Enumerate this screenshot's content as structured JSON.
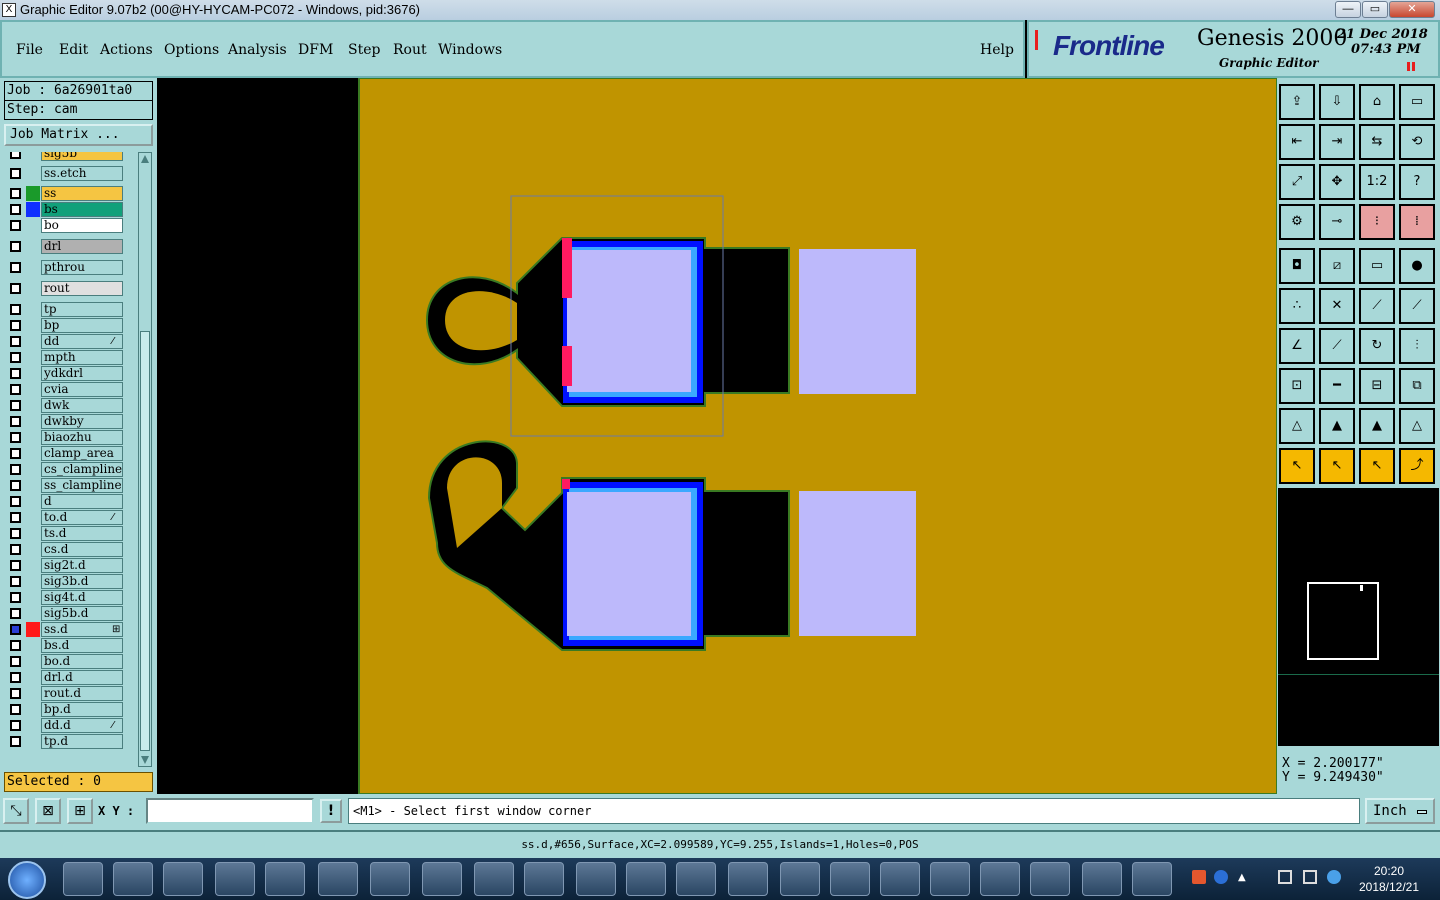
{
  "window": {
    "title": "Graphic Editor 9.07b2 (00@HY-HYCAM-PC072 - Windows, pid:3676)",
    "app_icon": "X",
    "minimize": "—",
    "maximize": "▭",
    "close": "✕"
  },
  "menu": {
    "file": "File",
    "edit": "Edit",
    "actions": "Actions",
    "options": "Options",
    "analysis": "Analysis",
    "dfm": "DFM",
    "step": "Step",
    "rout": "Rout",
    "windows": "Windows",
    "help": "Help"
  },
  "brand": {
    "logo": "Frontline",
    "product": "Genesis 2000",
    "subtitle": "Graphic Editor",
    "date": "21 Dec 2018",
    "time": "07:43 PM"
  },
  "job": {
    "job_label": "Job : 6a26901ta0",
    "step_label": "Step: cam",
    "matrix_button": "Job Matrix ..."
  },
  "layers": [
    {
      "name": "sig5b",
      "color": "#f5c542"
    },
    {
      "name": "ss.etch",
      "color": ""
    },
    {
      "name": "ss",
      "color": "#f5c542",
      "swatch": "#1a9a2a"
    },
    {
      "name": "bs",
      "color": "#11a07a",
      "swatch": "#1030ff"
    },
    {
      "name": "bo",
      "color": "#ffffff"
    },
    {
      "name": "drl",
      "color": "#b0b0b0"
    },
    {
      "name": "pthrou",
      "color": ""
    },
    {
      "name": "rout",
      "color": "#e0e0e0"
    },
    {
      "name": "tp",
      "color": ""
    },
    {
      "name": "bp",
      "color": ""
    },
    {
      "name": "dd",
      "color": "",
      "mark": "⁄"
    },
    {
      "name": "mpth",
      "color": ""
    },
    {
      "name": "ydkdrl",
      "color": ""
    },
    {
      "name": "cvia",
      "color": ""
    },
    {
      "name": "dwk",
      "color": ""
    },
    {
      "name": "dwkby",
      "color": ""
    },
    {
      "name": "biaozhu",
      "color": ""
    },
    {
      "name": "clamp_area",
      "color": ""
    },
    {
      "name": "cs_clampline",
      "color": ""
    },
    {
      "name": "ss_clampline",
      "color": ""
    },
    {
      "name": "d",
      "color": ""
    },
    {
      "name": "to.d",
      "color": "",
      "mark": "⁄"
    },
    {
      "name": "ts.d",
      "color": ""
    },
    {
      "name": "cs.d",
      "color": ""
    },
    {
      "name": "sig2t.d",
      "color": ""
    },
    {
      "name": "sig3b.d",
      "color": ""
    },
    {
      "name": "sig4t.d",
      "color": ""
    },
    {
      "name": "sig5b.d",
      "color": ""
    },
    {
      "name": "ss.d",
      "color": "",
      "swatch": "#ff1a1a",
      "mark": "⊞"
    },
    {
      "name": "bs.d",
      "color": ""
    },
    {
      "name": "bo.d",
      "color": ""
    },
    {
      "name": "drl.d",
      "color": ""
    },
    {
      "name": "rout.d",
      "color": ""
    },
    {
      "name": "bp.d",
      "color": ""
    },
    {
      "name": "dd.d",
      "color": "",
      "mark": "⁄"
    },
    {
      "name": "tp.d",
      "color": ""
    }
  ],
  "selected_label": "Selected : 0",
  "command": {
    "xy_label": "X Y :",
    "input_value": "",
    "prompt": "<M1> - Select first window corner",
    "units": "Inch",
    "warn_icon": "!"
  },
  "status": {
    "text": "ss.d,#656,Surface,XC=2.099589,YC=9.255,Islands=1,Holes=0,POS"
  },
  "coords": {
    "x": "X = 2.200177\"",
    "y": "Y = 9.249430\""
  },
  "toolbox": {
    "labels": {
      "one_to_one": "1:2",
      "help": "?"
    }
  },
  "taskbar": {
    "clock_time": "20:20",
    "clock_date": "2018/12/21"
  },
  "colors": {
    "board": "#c09400",
    "pad_fill": "#bdb9fb",
    "pad_outline_blue": "#0010ff",
    "pad_outline_light": "#3aa8ff",
    "mask_black": "#000000",
    "edge_green": "#3a7a22",
    "highlight_red": "#ff1a60",
    "panel": "#a8d8d8"
  }
}
